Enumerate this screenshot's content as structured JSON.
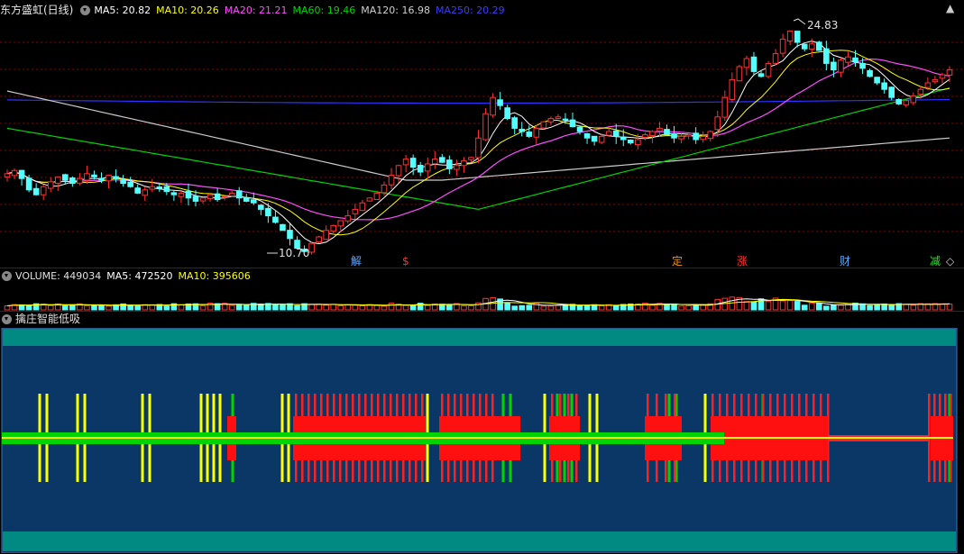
{
  "main_header": {
    "title": "东方盛虹(日线)",
    "ma5": "MA5: 20.82",
    "ma10": "MA10: 20.26",
    "ma20": "MA20: 21.21",
    "ma60": "MA60: 19.46",
    "ma120": "MA120: 16.98",
    "ma250": "MA250: 20.29"
  },
  "corner_icons": {
    "up": "▲",
    "down": "◇"
  },
  "price_labels": {
    "high": "24.83",
    "low": "10.70"
  },
  "signals": [
    {
      "label": "解",
      "color": "#5fa8ff"
    },
    {
      "label": "$",
      "color": "#ff3030"
    },
    {
      "label": "定",
      "color": "#ff8c1a"
    },
    {
      "label": "涨",
      "color": "#ff3030"
    },
    {
      "label": "财",
      "color": "#5fa8ff"
    },
    {
      "label": "减",
      "color": "#3cdc3c"
    }
  ],
  "volume_header": {
    "volume": "VOLUME: 449034",
    "ma5": "MA5: 472520",
    "ma10": "MA10: 395606"
  },
  "indicator_header": {
    "title": "擒庄智能低吸"
  },
  "colors": {
    "up": "#ff3232",
    "down": "#54ffff",
    "ma5": "#ffffff",
    "ma10": "#ffff00",
    "ma20": "#ff4dff",
    "ma60": "#00d400",
    "ma120": "#cccccc",
    "ma250": "#3030ff",
    "panel_bg": "#0a3766",
    "panel_band": "#008a82"
  },
  "chart_data": {
    "type": "candlestick",
    "title": "东方盛虹(日线)",
    "price_high_label": 24.83,
    "price_low_label": 10.7,
    "moving_averages": {
      "MA5": 20.82,
      "MA10": 20.26,
      "MA20": 21.21,
      "MA60": 19.46,
      "MA120": 16.98,
      "MA250": 20.29
    },
    "volume": {
      "VOLUME": 449034,
      "MA5": 472520,
      "MA10": 395606
    },
    "closes_approx": [
      15.8,
      16.0,
      15.5,
      14.8,
      14.5,
      15.0,
      15.3,
      15.6,
      15.4,
      15.2,
      15.5,
      15.8,
      15.6,
      15.4,
      15.7,
      15.5,
      15.2,
      15.0,
      14.6,
      14.8,
      15.0,
      14.9,
      14.7,
      14.5,
      14.6,
      14.3,
      14.1,
      14.3,
      14.5,
      14.2,
      14.4,
      14.6,
      14.3,
      14.1,
      14.0,
      13.6,
      13.2,
      12.8,
      12.3,
      11.8,
      11.2,
      11.0,
      11.5,
      11.9,
      12.3,
      12.6,
      12.9,
      13.2,
      13.6,
      14.0,
      14.3,
      14.6,
      15.1,
      15.7,
      16.3,
      16.7,
      16.2,
      15.9,
      16.4,
      16.7,
      16.5,
      16.1,
      16.3,
      16.6,
      16.8,
      18.0,
      19.5,
      20.5,
      20.0,
      19.2,
      18.6,
      18.4,
      18.1,
      18.6,
      19.0,
      19.2,
      19.3,
      19.1,
      18.7,
      18.4,
      18.0,
      17.8,
      18.1,
      18.4,
      18.1,
      17.9,
      17.7,
      17.9,
      18.2,
      18.4,
      18.6,
      18.2,
      18.0,
      18.1,
      18.2,
      17.9,
      18.1,
      18.4,
      19.3,
      20.5,
      21.6,
      22.4,
      22.9,
      22.1,
      21.8,
      22.6,
      23.2,
      24.1,
      24.6,
      23.9,
      23.5,
      23.8,
      23.4,
      22.6,
      22.2,
      22.8,
      23.0,
      22.7,
      22.3,
      21.8,
      21.4,
      21.0,
      20.5,
      20.1,
      20.3,
      20.6,
      21.0,
      21.4,
      21.6,
      21.9,
      22.2
    ]
  }
}
